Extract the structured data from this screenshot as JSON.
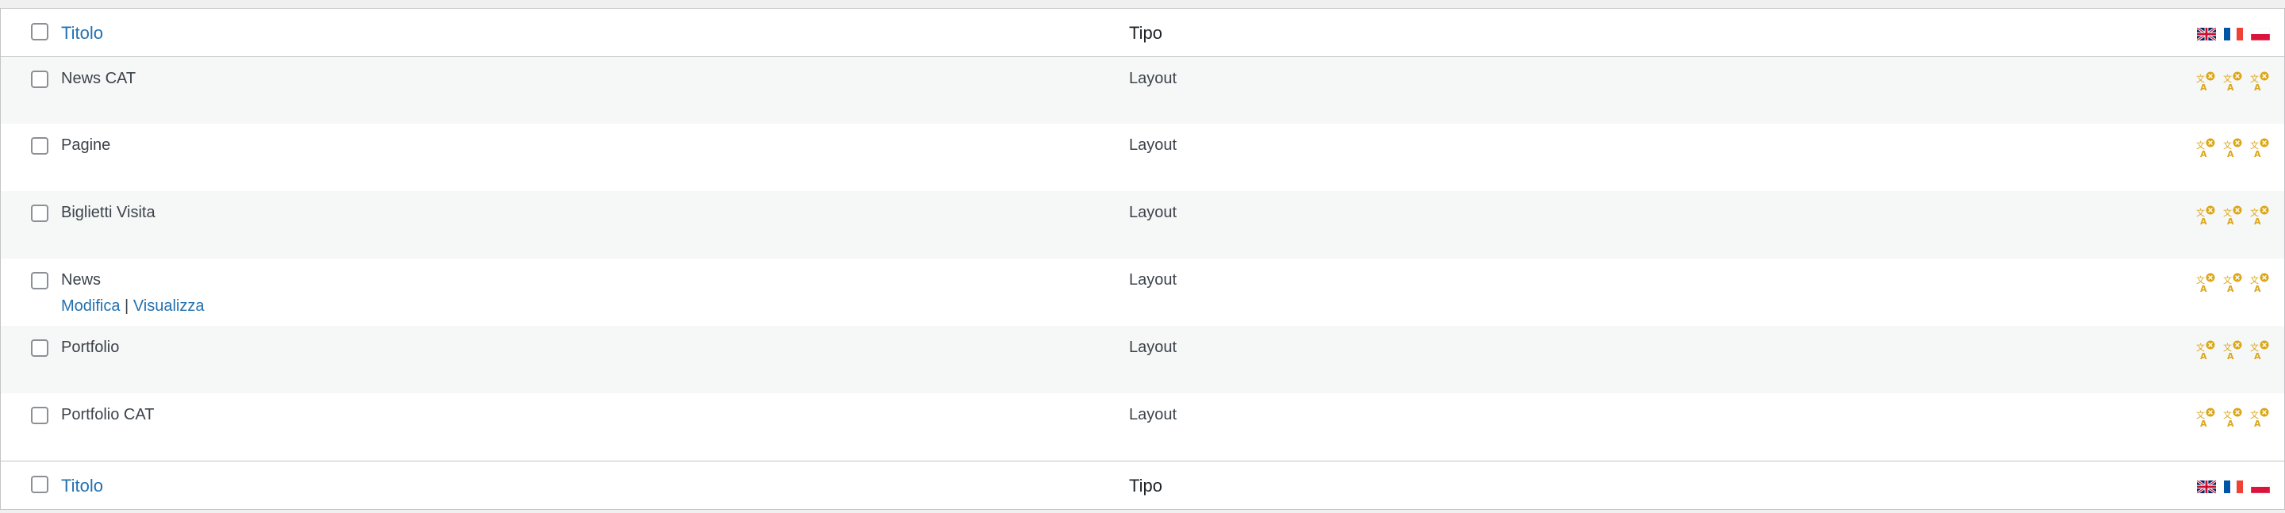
{
  "table": {
    "columns": {
      "title": "Titolo",
      "type": "Tipo"
    },
    "languages": [
      "flag-uk-icon",
      "flag-fr-icon",
      "flag-pl-icon"
    ],
    "rows": [
      {
        "title": "News CAT",
        "type": "Layout",
        "alt": true,
        "actions": null
      },
      {
        "title": "Pagine",
        "type": "Layout",
        "alt": false,
        "actions": null
      },
      {
        "title": "Biglietti Visita",
        "type": "Layout",
        "alt": true,
        "actions": null
      },
      {
        "title": "News",
        "type": "Layout",
        "alt": false,
        "actions": {
          "edit": "Modifica",
          "separator": "|",
          "view": "Visualizza"
        }
      },
      {
        "title": "Portfolio",
        "type": "Layout",
        "alt": true,
        "actions": null
      },
      {
        "title": "Portfolio CAT",
        "type": "Layout",
        "alt": false,
        "actions": null
      }
    ]
  },
  "colors": {
    "link": "#2271b1",
    "icon": "#dba617",
    "alt_row": "#f6f7f7"
  }
}
